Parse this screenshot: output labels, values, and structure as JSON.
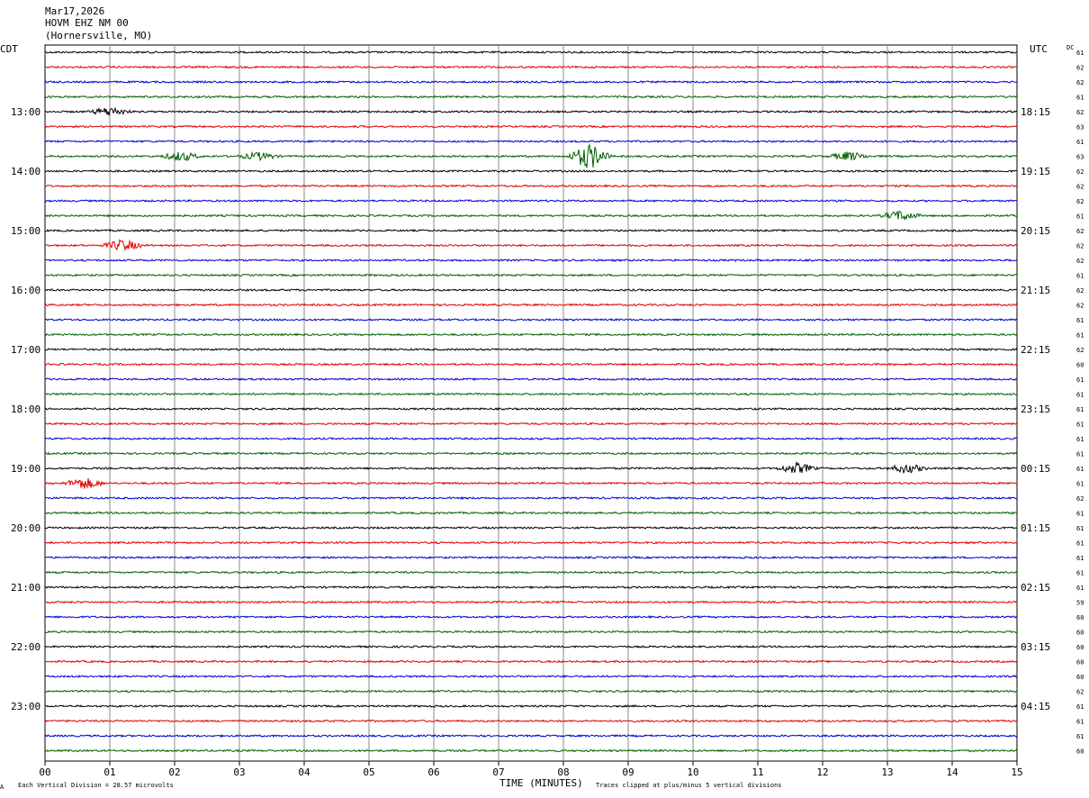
{
  "header": {
    "date": "Mar17,2026",
    "station": "HOVM EHZ NM 00",
    "location": "(Hornersville, MO)"
  },
  "left_zone": "CDT",
  "right_zone": "UTC",
  "dc_label": "DC",
  "footer": {
    "scale_note": "Each Vertical Division =   28.57 microvolts",
    "xlabel": "TIME (MINUTES)",
    "clip_note": "Traces clipped at plus/minus 5 vertical divisions",
    "corner_mark": "A"
  },
  "colors": {
    "black": "#000000",
    "red": "#e00000",
    "blue": "#0000d0",
    "green": "#006000",
    "grid": "#888888"
  },
  "chart_data": {
    "type": "line",
    "xlabel": "TIME (MINUTES)",
    "x_ticks": [
      "00",
      "01",
      "02",
      "03",
      "04",
      "05",
      "06",
      "07",
      "08",
      "09",
      "10",
      "11",
      "12",
      "13",
      "14",
      "15"
    ],
    "xlim": [
      0,
      15
    ],
    "left_hour_labels": [
      "13:00",
      "14:00",
      "15:00",
      "16:00",
      "17:00",
      "18:00",
      "19:00",
      "20:00",
      "21:00",
      "22:00",
      "23:00"
    ],
    "right_hour_labels": [
      "18:15",
      "19:15",
      "20:15",
      "21:15",
      "22:15",
      "23:15",
      "00:15",
      "01:15",
      "02:15",
      "03:15",
      "04:15"
    ],
    "trace_count": 48,
    "trace_color_cycle": [
      "black",
      "red",
      "blue",
      "green"
    ],
    "dc_offsets": [
      "61",
      "62",
      "62",
      "61",
      "62",
      "63",
      "61",
      "63",
      "62",
      "62",
      "62",
      "61",
      "62",
      "62",
      "62",
      "61",
      "62",
      "62",
      "61",
      "61",
      "62",
      "60",
      "61",
      "61",
      "61",
      "61",
      "61",
      "61",
      "61",
      "61",
      "62",
      "61",
      "61",
      "61",
      "61",
      "61",
      "61",
      "59",
      "60",
      "60",
      "60",
      "60",
      "60",
      "62",
      "61",
      "61",
      "61",
      "60"
    ],
    "events": [
      {
        "trace": 4,
        "minute": 1.0,
        "amplitude": 1.2
      },
      {
        "trace": 7,
        "minute": 2.1,
        "amplitude": 1.2
      },
      {
        "trace": 7,
        "minute": 3.3,
        "amplitude": 1.0
      },
      {
        "trace": 7,
        "minute": 8.4,
        "amplitude": 3.5
      },
      {
        "trace": 7,
        "minute": 12.4,
        "amplitude": 1.2
      },
      {
        "trace": 11,
        "minute": 13.2,
        "amplitude": 1.3
      },
      {
        "trace": 13,
        "minute": 1.2,
        "amplitude": 1.5
      },
      {
        "trace": 28,
        "minute": 11.6,
        "amplitude": 1.4
      },
      {
        "trace": 28,
        "minute": 13.3,
        "amplitude": 1.2
      },
      {
        "trace": 29,
        "minute": 0.6,
        "amplitude": 1.5
      }
    ]
  }
}
